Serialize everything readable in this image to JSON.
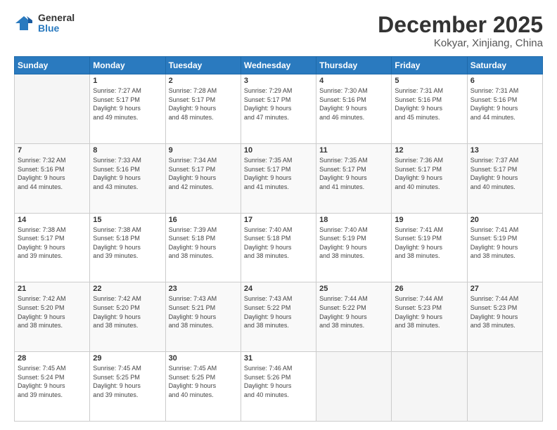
{
  "header": {
    "logo_general": "General",
    "logo_blue": "Blue",
    "month_year": "December 2025",
    "location": "Kokyar, Xinjiang, China"
  },
  "weekdays": [
    "Sunday",
    "Monday",
    "Tuesday",
    "Wednesday",
    "Thursday",
    "Friday",
    "Saturday"
  ],
  "weeks": [
    [
      {
        "day": "",
        "sunrise": "",
        "sunset": "",
        "daylight": ""
      },
      {
        "day": "1",
        "sunrise": "Sunrise: 7:27 AM",
        "sunset": "Sunset: 5:17 PM",
        "daylight": "Daylight: 9 hours and 49 minutes."
      },
      {
        "day": "2",
        "sunrise": "Sunrise: 7:28 AM",
        "sunset": "Sunset: 5:17 PM",
        "daylight": "Daylight: 9 hours and 48 minutes."
      },
      {
        "day": "3",
        "sunrise": "Sunrise: 7:29 AM",
        "sunset": "Sunset: 5:17 PM",
        "daylight": "Daylight: 9 hours and 47 minutes."
      },
      {
        "day": "4",
        "sunrise": "Sunrise: 7:30 AM",
        "sunset": "Sunset: 5:16 PM",
        "daylight": "Daylight: 9 hours and 46 minutes."
      },
      {
        "day": "5",
        "sunrise": "Sunrise: 7:31 AM",
        "sunset": "Sunset: 5:16 PM",
        "daylight": "Daylight: 9 hours and 45 minutes."
      },
      {
        "day": "6",
        "sunrise": "Sunrise: 7:31 AM",
        "sunset": "Sunset: 5:16 PM",
        "daylight": "Daylight: 9 hours and 44 minutes."
      }
    ],
    [
      {
        "day": "7",
        "sunrise": "Sunrise: 7:32 AM",
        "sunset": "Sunset: 5:16 PM",
        "daylight": "Daylight: 9 hours and 44 minutes."
      },
      {
        "day": "8",
        "sunrise": "Sunrise: 7:33 AM",
        "sunset": "Sunset: 5:16 PM",
        "daylight": "Daylight: 9 hours and 43 minutes."
      },
      {
        "day": "9",
        "sunrise": "Sunrise: 7:34 AM",
        "sunset": "Sunset: 5:17 PM",
        "daylight": "Daylight: 9 hours and 42 minutes."
      },
      {
        "day": "10",
        "sunrise": "Sunrise: 7:35 AM",
        "sunset": "Sunset: 5:17 PM",
        "daylight": "Daylight: 9 hours and 41 minutes."
      },
      {
        "day": "11",
        "sunrise": "Sunrise: 7:35 AM",
        "sunset": "Sunset: 5:17 PM",
        "daylight": "Daylight: 9 hours and 41 minutes."
      },
      {
        "day": "12",
        "sunrise": "Sunrise: 7:36 AM",
        "sunset": "Sunset: 5:17 PM",
        "daylight": "Daylight: 9 hours and 40 minutes."
      },
      {
        "day": "13",
        "sunrise": "Sunrise: 7:37 AM",
        "sunset": "Sunset: 5:17 PM",
        "daylight": "Daylight: 9 hours and 40 minutes."
      }
    ],
    [
      {
        "day": "14",
        "sunrise": "Sunrise: 7:38 AM",
        "sunset": "Sunset: 5:17 PM",
        "daylight": "Daylight: 9 hours and 39 minutes."
      },
      {
        "day": "15",
        "sunrise": "Sunrise: 7:38 AM",
        "sunset": "Sunset: 5:18 PM",
        "daylight": "Daylight: 9 hours and 39 minutes."
      },
      {
        "day": "16",
        "sunrise": "Sunrise: 7:39 AM",
        "sunset": "Sunset: 5:18 PM",
        "daylight": "Daylight: 9 hours and 38 minutes."
      },
      {
        "day": "17",
        "sunrise": "Sunrise: 7:40 AM",
        "sunset": "Sunset: 5:18 PM",
        "daylight": "Daylight: 9 hours and 38 minutes."
      },
      {
        "day": "18",
        "sunrise": "Sunrise: 7:40 AM",
        "sunset": "Sunset: 5:19 PM",
        "daylight": "Daylight: 9 hours and 38 minutes."
      },
      {
        "day": "19",
        "sunrise": "Sunrise: 7:41 AM",
        "sunset": "Sunset: 5:19 PM",
        "daylight": "Daylight: 9 hours and 38 minutes."
      },
      {
        "day": "20",
        "sunrise": "Sunrise: 7:41 AM",
        "sunset": "Sunset: 5:19 PM",
        "daylight": "Daylight: 9 hours and 38 minutes."
      }
    ],
    [
      {
        "day": "21",
        "sunrise": "Sunrise: 7:42 AM",
        "sunset": "Sunset: 5:20 PM",
        "daylight": "Daylight: 9 hours and 38 minutes."
      },
      {
        "day": "22",
        "sunrise": "Sunrise: 7:42 AM",
        "sunset": "Sunset: 5:20 PM",
        "daylight": "Daylight: 9 hours and 38 minutes."
      },
      {
        "day": "23",
        "sunrise": "Sunrise: 7:43 AM",
        "sunset": "Sunset: 5:21 PM",
        "daylight": "Daylight: 9 hours and 38 minutes."
      },
      {
        "day": "24",
        "sunrise": "Sunrise: 7:43 AM",
        "sunset": "Sunset: 5:22 PM",
        "daylight": "Daylight: 9 hours and 38 minutes."
      },
      {
        "day": "25",
        "sunrise": "Sunrise: 7:44 AM",
        "sunset": "Sunset: 5:22 PM",
        "daylight": "Daylight: 9 hours and 38 minutes."
      },
      {
        "day": "26",
        "sunrise": "Sunrise: 7:44 AM",
        "sunset": "Sunset: 5:23 PM",
        "daylight": "Daylight: 9 hours and 38 minutes."
      },
      {
        "day": "27",
        "sunrise": "Sunrise: 7:44 AM",
        "sunset": "Sunset: 5:23 PM",
        "daylight": "Daylight: 9 hours and 38 minutes."
      }
    ],
    [
      {
        "day": "28",
        "sunrise": "Sunrise: 7:45 AM",
        "sunset": "Sunset: 5:24 PM",
        "daylight": "Daylight: 9 hours and 39 minutes."
      },
      {
        "day": "29",
        "sunrise": "Sunrise: 7:45 AM",
        "sunset": "Sunset: 5:25 PM",
        "daylight": "Daylight: 9 hours and 39 minutes."
      },
      {
        "day": "30",
        "sunrise": "Sunrise: 7:45 AM",
        "sunset": "Sunset: 5:25 PM",
        "daylight": "Daylight: 9 hours and 40 minutes."
      },
      {
        "day": "31",
        "sunrise": "Sunrise: 7:46 AM",
        "sunset": "Sunset: 5:26 PM",
        "daylight": "Daylight: 9 hours and 40 minutes."
      },
      {
        "day": "",
        "sunrise": "",
        "sunset": "",
        "daylight": ""
      },
      {
        "day": "",
        "sunrise": "",
        "sunset": "",
        "daylight": ""
      },
      {
        "day": "",
        "sunrise": "",
        "sunset": "",
        "daylight": ""
      }
    ]
  ]
}
